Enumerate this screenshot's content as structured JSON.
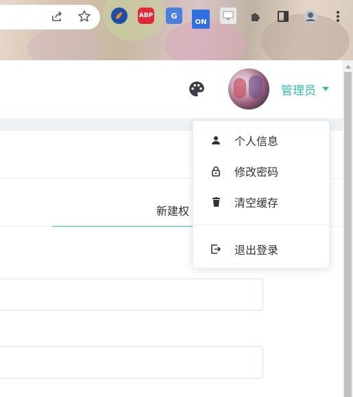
{
  "browser": {
    "toolbar_icons": [
      "share-icon",
      "star-icon",
      "puzzle-icon",
      "side-panel-icon",
      "profile-icon",
      "more-icon"
    ],
    "extensions": [
      {
        "name": "ext-firefox-like-icon",
        "color": "#2b5fb3"
      },
      {
        "name": "abp-icon",
        "label": "ABP",
        "color": "#e0293b"
      },
      {
        "name": "translate-icon",
        "color": "#4a7fe0"
      },
      {
        "name": "on-icon",
        "label": "ON",
        "color": "#2f6fe0"
      },
      {
        "name": "screen-icon",
        "color": "#d0d0d0"
      }
    ]
  },
  "header": {
    "user_name": "管理员",
    "accent_color": "#2fbdb3"
  },
  "tab": {
    "label": "新建权"
  },
  "dropdown": {
    "items": [
      {
        "label": "个人信息",
        "icon": "user-icon"
      },
      {
        "label": "修改密码",
        "icon": "lock-icon"
      },
      {
        "label": "清空缓存",
        "icon": "trash-icon"
      },
      {
        "label": "退出登录",
        "icon": "logout-icon"
      }
    ]
  }
}
